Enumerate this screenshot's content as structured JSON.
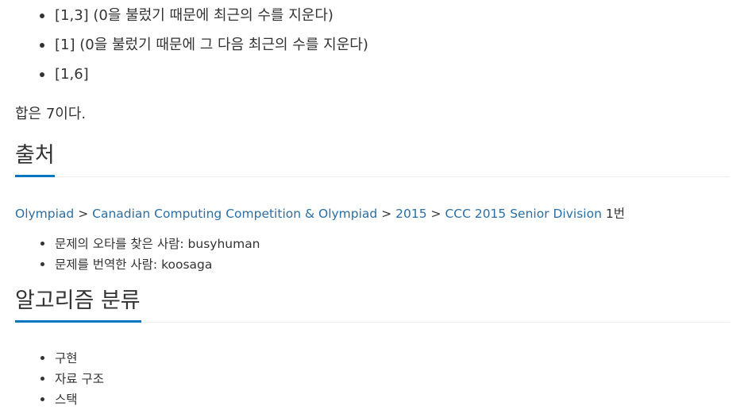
{
  "examples": [
    "[1,3] (0을 불렀기 때문에 최근의 수를 지운다)",
    "[1] (0을 불렀기 때문에 그 다음 최근의 수를 지운다)",
    "[1,6]"
  ],
  "sum_text": "합은 7이다.",
  "source": {
    "heading": "출처",
    "breadcrumb": [
      "Olympiad",
      "Canadian Computing Competition & Olympiad",
      "2015",
      "CCC 2015 Senior Division"
    ],
    "separator": ">",
    "problem_number": "1번",
    "credits": [
      "문제의 오타를 찾은 사람: busyhuman",
      "문제를 번역한 사람: koosaga"
    ]
  },
  "algorithms": {
    "heading": "알고리즘 분류",
    "tags": [
      "구현",
      "자료 구조",
      "스택"
    ]
  }
}
